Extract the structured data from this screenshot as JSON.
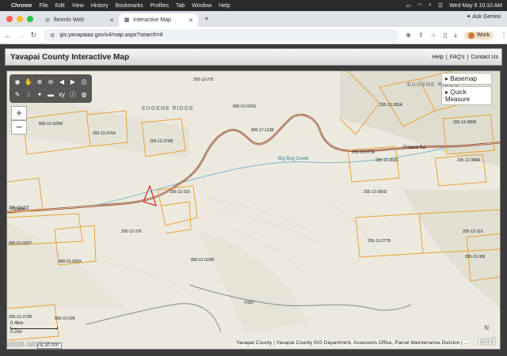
{
  "menubar": {
    "app": "Chrome",
    "items": [
      "File",
      "Edit",
      "View",
      "History",
      "Bookmarks",
      "Profiles",
      "Tab",
      "Window",
      "Help"
    ],
    "datetime": "Wed May 6  10:10 AM"
  },
  "tabs": [
    {
      "label": "flexmls Web",
      "active": false
    },
    {
      "label": "Interactive Map",
      "active": true
    }
  ],
  "ask_gemini": "Ask Gemini",
  "address": {
    "url": "gis.yavapaiaz.gov/v4/map.aspx?search=#"
  },
  "profile": {
    "label": "Work"
  },
  "site": {
    "title": "Yavapai County Interactive Map",
    "links": [
      "Help",
      "FAQ's",
      "Contact Us"
    ]
  },
  "map": {
    "widgets": [
      "Basemap",
      "Quick Measure"
    ],
    "place_names": [
      "EUGENE RIDGE",
      "EUGENE RIDGE"
    ],
    "creek_label": "Big Bug Creek",
    "road_labels": [
      "Poland Rd",
      "FS9484",
      "FS97"
    ],
    "parcel_labels": [
      "205-13-275",
      "800-01-029S",
      "800-17-113B",
      "205-13-383A",
      "205-13-385B",
      "800-01-029W",
      "205-13-374A",
      "205-13-374B",
      "205-13-377A",
      "205-13-363C",
      "205-13-389A",
      "205-13-313",
      "205-13-319",
      "205-13-365D",
      "205-13-377B",
      "800-01-029Y",
      "205-13-376",
      "205-13-319",
      "800-01-029X",
      "800-01-029R",
      "205-13-366",
      "205-13-372B",
      "800-01-028"
    ],
    "scale_km": "0.4km",
    "scale_mi": "0.2mi",
    "scale_ratio": "1:20,000",
    "attribution": "Yavapai County | Yavapai County GIS Department, Assessors Office, Parcel Maintenance Division | ...",
    "esri": "esri",
    "north": "N",
    "watermark": "©2026 ARMLS"
  },
  "colors": {
    "parcel": "#e8a23a",
    "road": "#8c3b2b",
    "red_parcel": "#d62828"
  }
}
